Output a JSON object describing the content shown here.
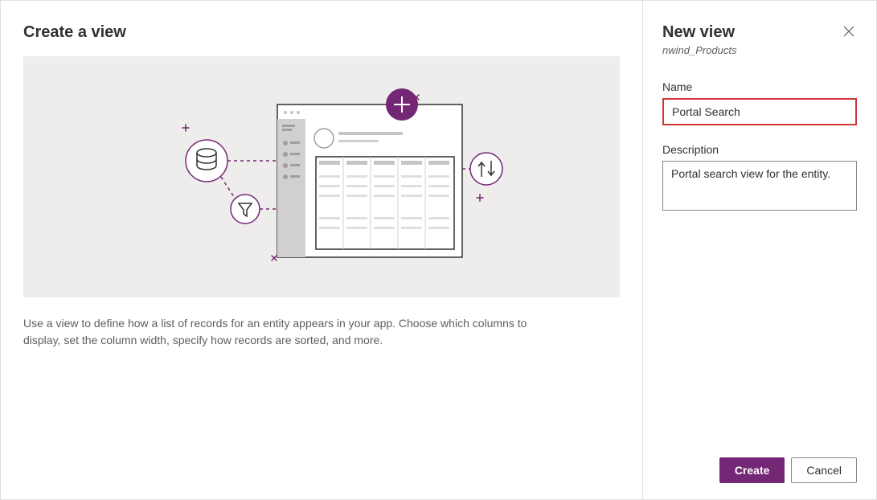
{
  "left": {
    "title": "Create a view",
    "help_text": "Use a view to define how a list of records for an entity appears in your app. Choose which columns to display, set the column width, specify how records are sorted, and more."
  },
  "right": {
    "title": "New view",
    "entity": "nwind_Products",
    "name_label": "Name",
    "name_value": "Portal Search",
    "desc_label": "Description",
    "desc_value": "Portal search view for the entity."
  },
  "footer": {
    "create_label": "Create",
    "cancel_label": "Cancel"
  },
  "colors": {
    "accent": "#742774",
    "error_border": "#d13438"
  }
}
